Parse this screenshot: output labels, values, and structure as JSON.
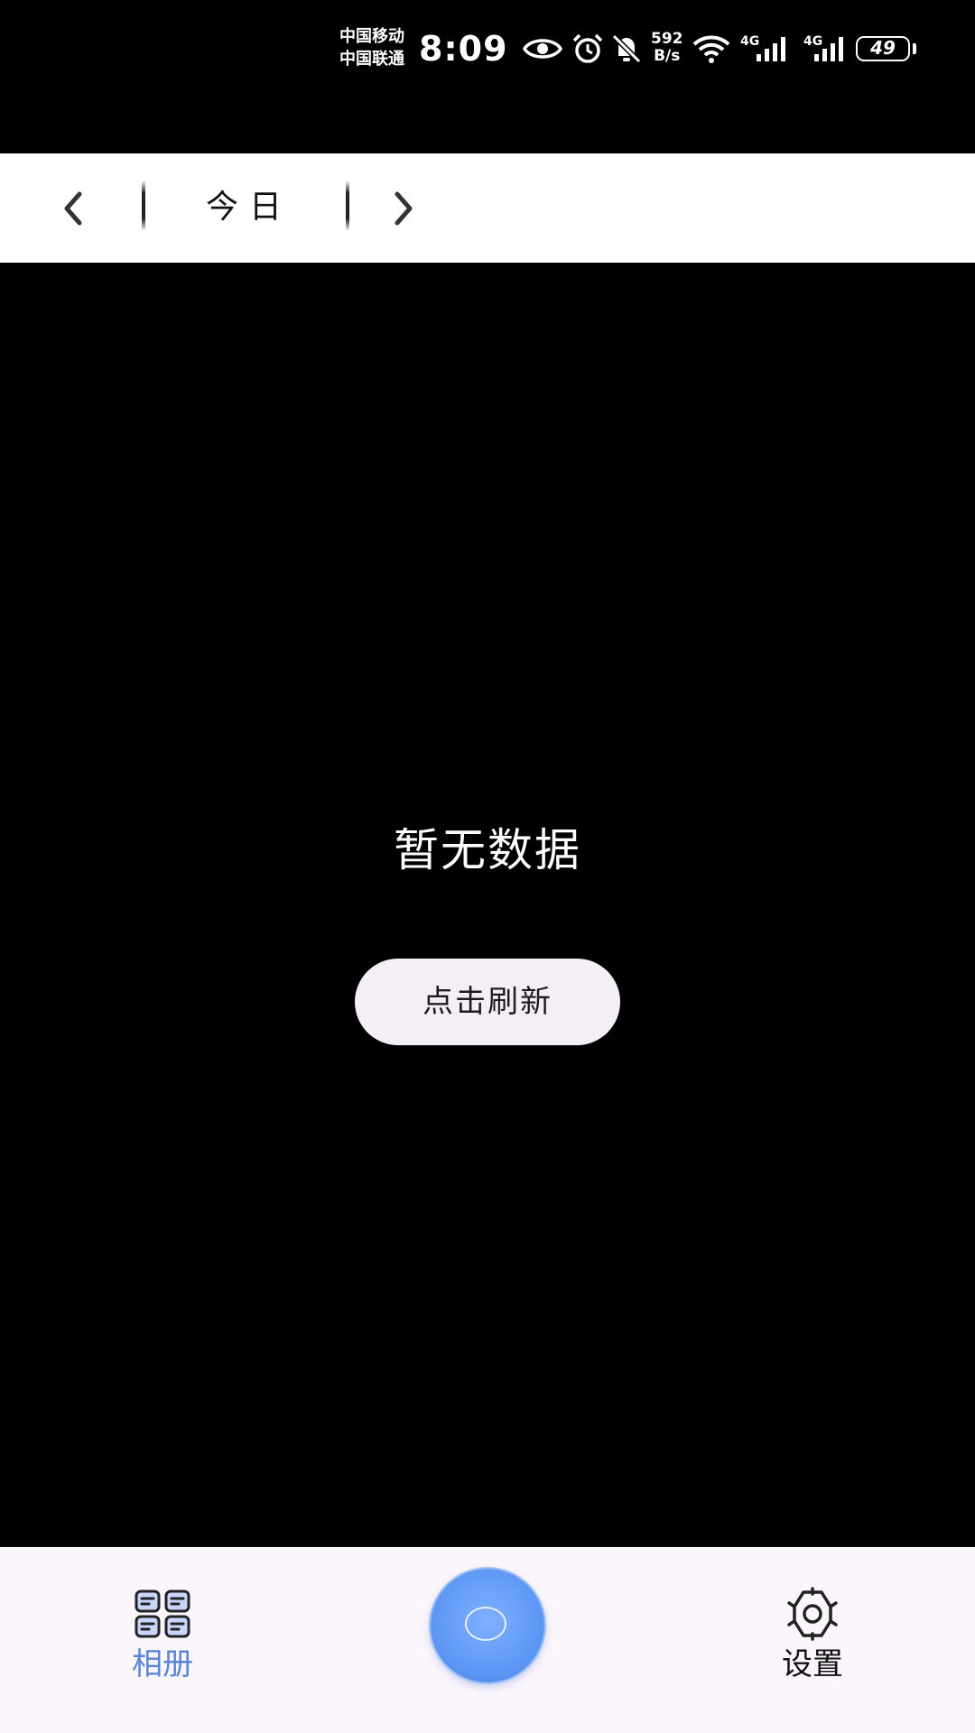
{
  "status_bar": {
    "carrier_1": "中国移动",
    "carrier_2": "中国联通",
    "time": "8:09",
    "net_speed_value": "592",
    "net_speed_unit": "B/s",
    "network_type_1": "4G",
    "network_type_2": "4G",
    "battery_level": "49",
    "icons": [
      "eye-icon",
      "alarm-icon",
      "mute-bell-icon",
      "wifi-icon",
      "signal-icon",
      "signal-icon",
      "battery-icon"
    ]
  },
  "date_nav": {
    "label": "今日",
    "prev_icon": "chevron-left-icon",
    "next_icon": "chevron-right-icon"
  },
  "empty_state": {
    "message": "暂无数据",
    "refresh_label": "点击刷新"
  },
  "bottom_nav": {
    "items": [
      {
        "label": "相册",
        "icon": "album-grid-icon",
        "active": true
      },
      {
        "label": "设置",
        "icon": "gear-icon",
        "active": false
      }
    ],
    "center_button_icon": "shutter-icon"
  },
  "colors": {
    "background": "#000000",
    "date_bar": "#ffffff",
    "refresh_button": "#f4eff6",
    "bottom_nav": "#fbf6fc",
    "active_nav": "#5b85d6",
    "fab": "#5f98f5"
  }
}
